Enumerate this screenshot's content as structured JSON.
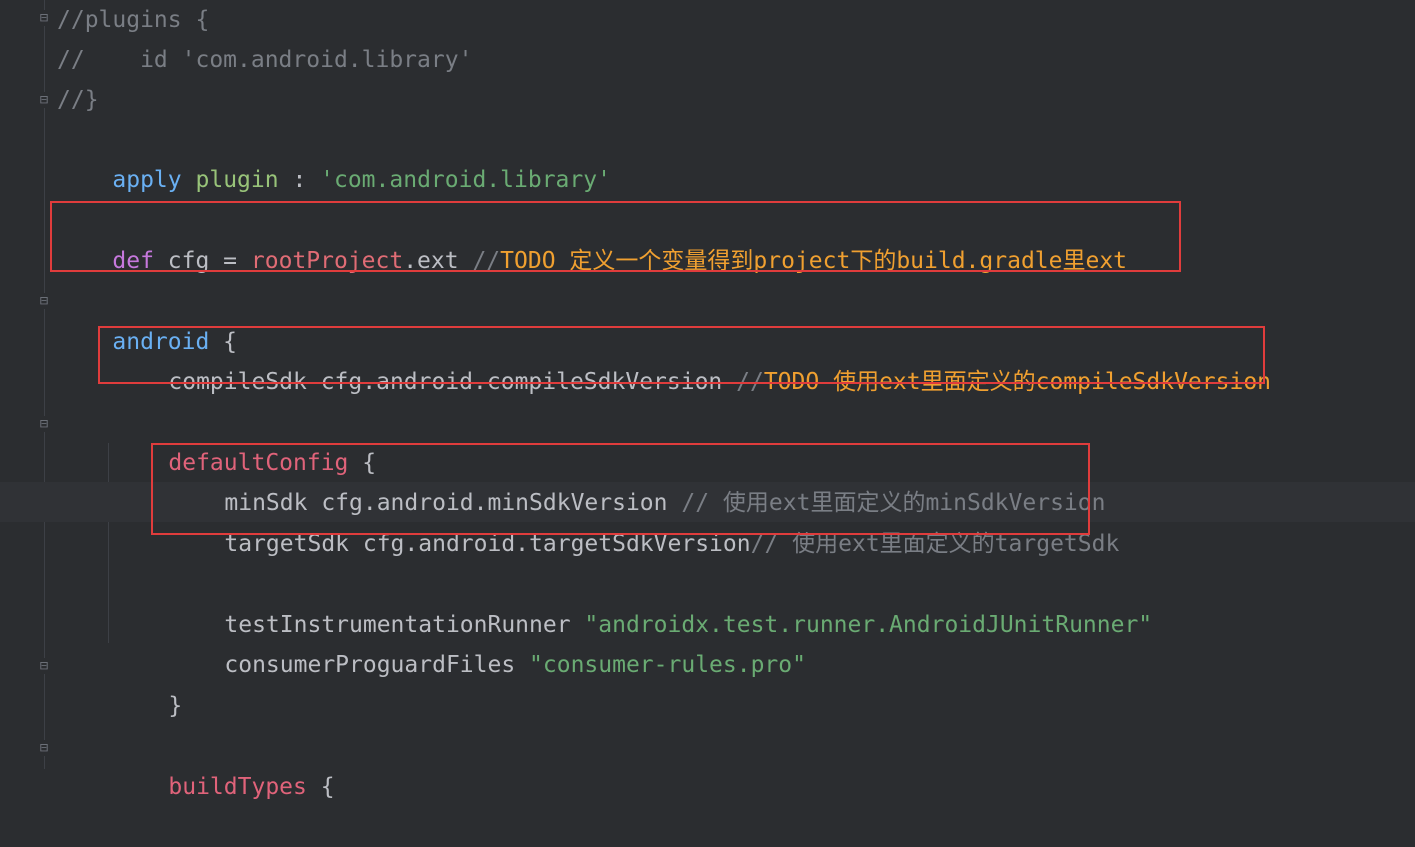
{
  "lines": {
    "l1": {
      "text": "//plugins {"
    },
    "l2": {
      "text": "//    id 'com.android.library'"
    },
    "l3": {
      "text": "//}"
    },
    "l4": {
      "kw": "apply",
      "plugin": "plugin",
      "colon": " : ",
      "str": "'com.android.library'"
    },
    "l6": {
      "kw": "def",
      "rest": " cfg = ",
      "root": "rootProject",
      "ext": ".ext ",
      "cm": "//",
      "todo": "TODO 定义一个变量得到project下的build.gradle里ext"
    },
    "l8": {
      "kw": "android",
      "brace": " {"
    },
    "l9": {
      "code": "compileSdk cfg.android.compileSdkVersion ",
      "cm": "//",
      "todo": "TODO 使用ext里面定义的compileSdkVersion"
    },
    "l11": {
      "blk": "defaultConfig",
      "brace": " {"
    },
    "l12": {
      "code": "minSdk cfg.android.minSdkVersion ",
      "cm": "// 使用ext里面定义的minSdkVersion"
    },
    "l13": {
      "code": "targetSdk cfg.android.targetSdkVersion",
      "cm": "// 使用ext里面定义的targetSdk"
    },
    "l15": {
      "code": "testInstrumentationRunner ",
      "str": "\"androidx.test.runner.AndroidJUnitRunner\""
    },
    "l16": {
      "code": "consumerProguardFiles ",
      "str": "\"consumer-rules.pro\""
    },
    "l17": {
      "brace": "}"
    },
    "l19": {
      "blk": "buildTypes",
      "brace": " {"
    }
  },
  "colors": {
    "background": "#2b2d30",
    "highlight_box": "#e03c3c",
    "todo": "#f0a030",
    "keyword": "#6ab0f3",
    "string": "#6aab73"
  }
}
